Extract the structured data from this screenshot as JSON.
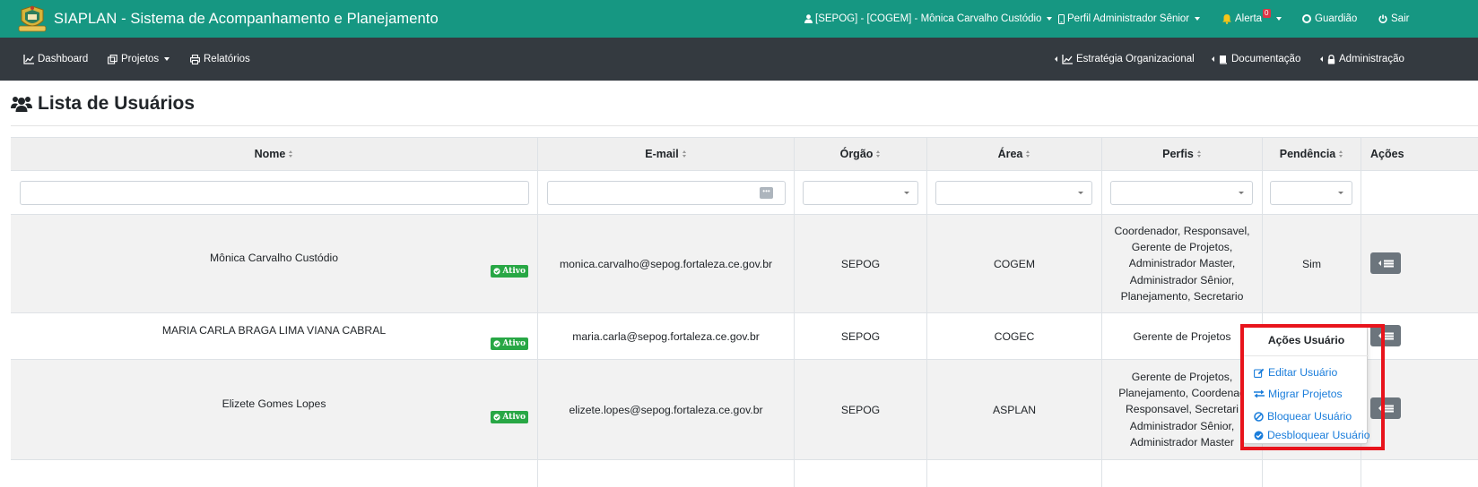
{
  "topbar": {
    "brand": "SIAPLAN - Sistema de Acompanhamento e Planejamento",
    "user": "[SEPOG] - [COGEM] - Mônica Carvalho Custódio",
    "profile": "Perfil Administrador Sênior",
    "alert": "Alerta",
    "alert_count": "0",
    "guardian": "Guardião",
    "exit": "Sair"
  },
  "menubar": {
    "dashboard": "Dashboard",
    "projects": "Projetos",
    "reports": "Relatórios",
    "strategy": "Estratégia Organizacional",
    "docs": "Documentação",
    "admin": "Administração"
  },
  "page": {
    "title": "Lista de Usuários"
  },
  "table": {
    "headers": [
      "Nome",
      "E-mail",
      "Órgão",
      "Área",
      "Perfis",
      "Pendência",
      "Ações"
    ],
    "status_label": "Ativo",
    "rows": [
      {
        "name": "Mônica Carvalho Custódio",
        "email": "monica.carvalho@sepog.fortaleza.ce.gov.br",
        "orgao": "SEPOG",
        "area": "COGEM",
        "perfis": [
          "Coordenador, Responsavel,",
          "Gerente de Projetos,",
          "Administrador Master,",
          "Administrador Sênior,",
          "Planejamento, Secretario"
        ],
        "pendencia": "Sim"
      },
      {
        "name": "MARIA CARLA BRAGA LIMA VIANA CABRAL",
        "email": "maria.carla@sepog.fortaleza.ce.gov.br",
        "orgao": "SEPOG",
        "area": "COGEC",
        "perfis": [
          "Gerente de Projetos"
        ],
        "pendencia": ""
      },
      {
        "name": "Elizete Gomes Lopes",
        "email": "elizete.lopes@sepog.fortaleza.ce.gov.br",
        "orgao": "SEPOG",
        "area": "ASPLAN",
        "perfis": [
          "Gerente de Projetos,",
          "Planejamento, Coordenad",
          "Responsavel, Secretari",
          "Administrador Sênior,",
          "Administrador Master"
        ],
        "pendencia": ""
      }
    ]
  },
  "dropdown": {
    "header": "Ações Usuário",
    "items": [
      "Editar Usuário",
      "Migrar Projetos",
      "Bloquear Usuário",
      "Desbloquear Usuário"
    ]
  },
  "colors": {
    "topbar": "#169782",
    "menubar": "#343a40",
    "link": "#1a7ddb",
    "badge": "#28a745",
    "highlight": "#e8141c"
  }
}
